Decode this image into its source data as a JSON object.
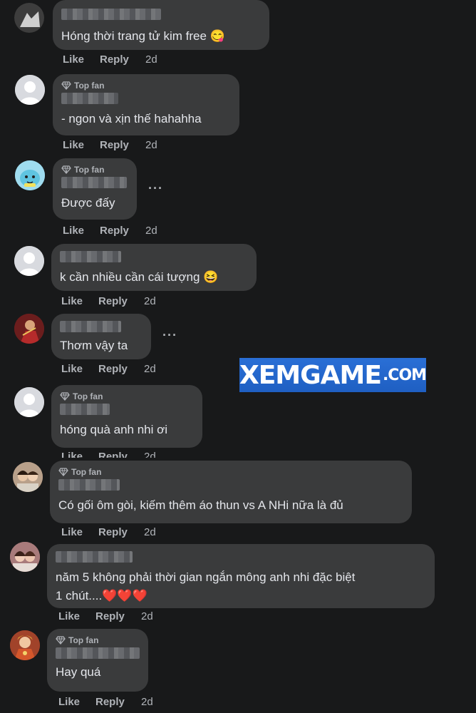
{
  "labels": {
    "like": "Like",
    "reply": "Reply",
    "top_fan": "Top fan"
  },
  "watermark": {
    "main": "XEMGAME",
    "suffix": ".COM"
  },
  "comments": [
    {
      "text": "Hóng thời trang tử kim free",
      "time": "2d",
      "top_fan": false,
      "emoji": "😋"
    },
    {
      "text": "- ngon và xịn thế hahahha",
      "time": "2d",
      "top_fan": true
    },
    {
      "text": "Được đấy",
      "time": "2d",
      "top_fan": true
    },
    {
      "text": "k cần nhiều cần cái tượng",
      "time": "2d",
      "top_fan": false,
      "emoji": "😆"
    },
    {
      "text": "Thơm vậy ta",
      "time": "2d",
      "top_fan": false
    },
    {
      "text": "hóng quà anh nhi ơi",
      "time": "2d",
      "top_fan": true
    },
    {
      "text": "Có gối ôm gòi, kiếm thêm áo thun vs A NHi nữa là đủ",
      "time": "2d",
      "top_fan": true
    },
    {
      "text": "năm 5 không phải thời gian ngắn mông anh nhi đặc biệt\n1 chút....❤️❤️❤️",
      "time": "2d",
      "top_fan": false
    },
    {
      "text": "Hay quá",
      "time": "2d",
      "top_fan": true
    }
  ]
}
